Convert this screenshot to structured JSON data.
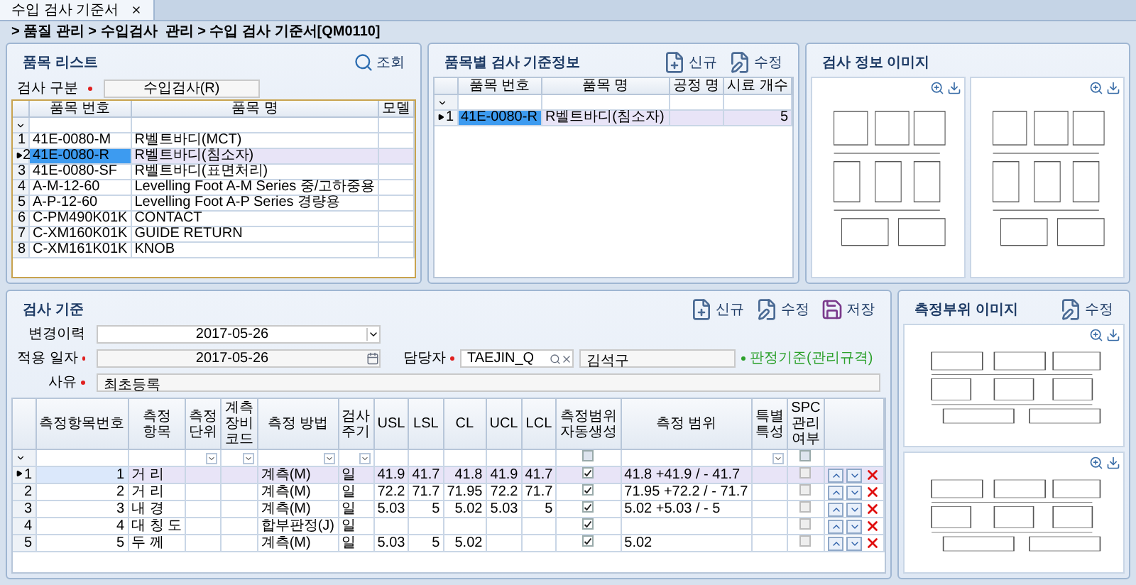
{
  "tab": {
    "label": "수입 검사 기준서",
    "selected": true
  },
  "breadcrumb": "> 품질 관리 > 수입검사  관리 > 수입 검사 기준서[QM0110]",
  "item_list": {
    "title": "품목 리스트",
    "search_button": "조회",
    "filter": {
      "label": "검사 구분",
      "required": true,
      "value": "수입검사(R)"
    },
    "columns": [
      "품목 번호",
      "품목 명",
      "모델"
    ],
    "rows": [
      {
        "no": "1",
        "code": "41E-0080-M",
        "name": "R벨트바디(MCT)",
        "selected": false
      },
      {
        "no": "2",
        "code": "41E-0080-R",
        "name": "R벨트바디(침소자)",
        "selected": true
      },
      {
        "no": "3",
        "code": "41E-0080-SF",
        "name": "R벨트바디(표면처리)",
        "selected": false
      },
      {
        "no": "4",
        "code": "A-M-12-60",
        "name": "Levelling Foot A-M Series 중/고하중용",
        "selected": false
      },
      {
        "no": "5",
        "code": "A-P-12-60",
        "name": "Levelling Foot A-P Series 경량용",
        "selected": false
      },
      {
        "no": "6",
        "code": "C-PM490K01K",
        "name": "CONTACT",
        "selected": false
      },
      {
        "no": "7",
        "code": "C-XM160K01K",
        "name": "GUIDE RETURN",
        "selected": false
      },
      {
        "no": "8",
        "code": "C-XM161K01K",
        "name": "KNOB",
        "selected": false
      }
    ]
  },
  "standard_info": {
    "title": "품목별 검사 기준정보",
    "buttons": [
      {
        "kind": "new",
        "label": "신규"
      },
      {
        "kind": "edit",
        "label": "수정"
      }
    ],
    "columns": [
      "품목 번호",
      "품목 명",
      "공정 명",
      "시료 개수"
    ],
    "rows": [
      {
        "no": "1",
        "code": "41E-0080-R",
        "name": "R벨트바디(침소자)",
        "process": "",
        "samples": "5",
        "selected": true
      }
    ]
  },
  "inspection_images": {
    "title": "검사 정보 이미지"
  },
  "inspection_standard": {
    "title": "검사 기준",
    "buttons": [
      {
        "kind": "new",
        "label": "신규"
      },
      {
        "kind": "edit",
        "label": "수정"
      },
      {
        "kind": "save",
        "label": "저장"
      }
    ],
    "history": {
      "label": "변경이력",
      "value": "2017-05-26"
    },
    "apply_date": {
      "label": "적용 일자",
      "required": true,
      "value": "2017-05-26"
    },
    "manager": {
      "label": "담당자",
      "required": true,
      "value": "TAEJIN_Q",
      "name": "김석구"
    },
    "legend": "판정기준(관리규격)",
    "reason": {
      "label": "사유",
      "required": true,
      "value": "최초등록"
    },
    "columns": [
      {
        "label": "측정항목번호",
        "kind": "plain"
      },
      {
        "label": "측정 항목",
        "kind": "plain"
      },
      {
        "label": "측정 단위",
        "kind": "dropdown"
      },
      {
        "label": "계측 장비 코드",
        "kind": "dropdown"
      },
      {
        "label": "측정 방법",
        "kind": "dropdown"
      },
      {
        "label": "검사 주기",
        "kind": "dropdown"
      },
      {
        "label": "USL",
        "kind": "plain"
      },
      {
        "label": "LSL",
        "kind": "plain"
      },
      {
        "label": "CL",
        "kind": "plain"
      },
      {
        "label": "UCL",
        "kind": "plain"
      },
      {
        "label": "LCL",
        "kind": "plain"
      },
      {
        "label": "측정범위 자동생성",
        "kind": "checkbox",
        "checked": false
      },
      {
        "label": "측정 범위",
        "kind": "plain"
      },
      {
        "label": "특별 특성",
        "kind": "dropdown"
      },
      {
        "label": "SPC 관리 여부",
        "kind": "checkbox",
        "checked": false
      }
    ],
    "rows": [
      {
        "no": "1",
        "selected": true,
        "cells": [
          "1",
          "거 리",
          "",
          "",
          "계측(M)",
          "일",
          "41.9",
          "41.7",
          "41.8",
          "41.9",
          "41.7"
        ],
        "auto_range": true,
        "range": "41.8 +41.9 / - 41.7",
        "special": "",
        "spc": false
      },
      {
        "no": "2",
        "selected": false,
        "cells": [
          "2",
          "거 리",
          "",
          "",
          "계측(M)",
          "일",
          "72.2",
          "71.7",
          "71.95",
          "72.2",
          "71.7"
        ],
        "auto_range": true,
        "range": "71.95 +72.2 / - 71.7",
        "special": "",
        "spc": false
      },
      {
        "no": "3",
        "selected": false,
        "cells": [
          "3",
          "내 경",
          "",
          "",
          "계측(M)",
          "일",
          "5.03",
          "5",
          "5.02",
          "5.03",
          "5"
        ],
        "auto_range": true,
        "range": "5.02 +5.03 / - 5",
        "special": "",
        "spc": false
      },
      {
        "no": "4",
        "selected": false,
        "cells": [
          "4",
          "대 칭 도",
          "",
          "",
          "합부판정(J)",
          "일",
          "",
          "",
          "",
          "",
          ""
        ],
        "auto_range": true,
        "range": "",
        "special": "",
        "spc": false
      },
      {
        "no": "5",
        "selected": false,
        "cells": [
          "5",
          "두 께",
          "",
          "",
          "계측(M)",
          "일",
          "5.03",
          "5",
          "5.02",
          "",
          ""
        ],
        "auto_range": true,
        "range": "5.02",
        "special": "",
        "spc": false
      }
    ]
  },
  "part_image": {
    "title": "측정부위 이미지",
    "button": {
      "kind": "edit",
      "label": "수정"
    }
  }
}
